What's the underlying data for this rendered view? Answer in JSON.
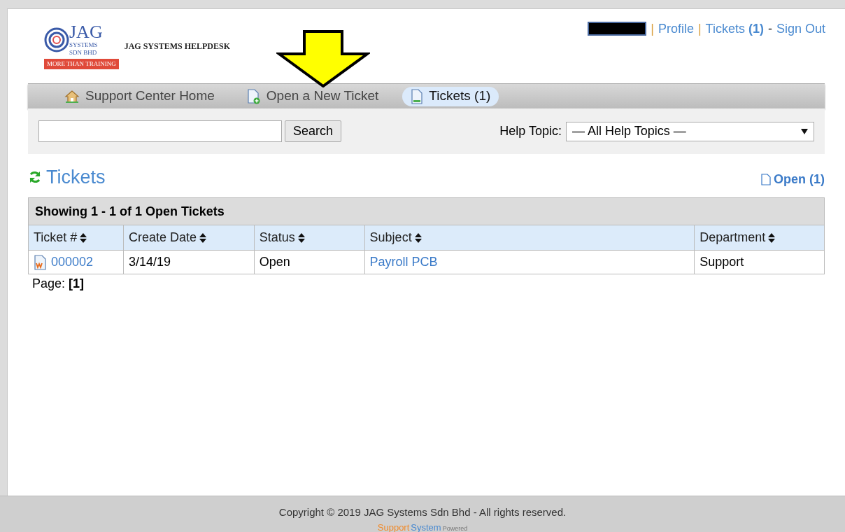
{
  "header": {
    "logo": {
      "main": "JAG",
      "sub": "SYSTEMS SDN BHD",
      "tagline": "MORE THAN TRAINING"
    },
    "site_title": "JAG SYSTEMS HELPDESK",
    "user_nav": [
      {
        "kind": "separator",
        "text": "|"
      },
      {
        "kind": "link",
        "text": "Profile"
      },
      {
        "kind": "separator",
        "text": "|"
      },
      {
        "kind": "link",
        "text": "Tickets **(1)**"
      },
      {
        "kind": "dash",
        "text": "-"
      },
      {
        "kind": "link",
        "text": "Sign Out"
      }
    ]
  },
  "nav_tabs": [
    {
      "label": "Support Center Home",
      "kind": "home",
      "selected": false
    },
    {
      "label": "Open a New Ticket",
      "kind": "new",
      "selected": false
    },
    {
      "label": "Tickets (1)",
      "kind": "doc",
      "selected": true
    }
  ],
  "search": {
    "button": "Search"
  },
  "help_topic": {
    "label": "Help Topic:",
    "value": "— All Help Topics —"
  },
  "tickets": {
    "title": "Tickets",
    "filter": "Open (1)",
    "caption": "Showing 1 - 1 of 1 Open Tickets",
    "columns": [
      "Ticket #",
      "Create Date",
      "Status",
      "Subject",
      "Department"
    ],
    "rows": [
      {
        "ticket": "000002",
        "date": "3/14/19",
        "status": "Open",
        "subject": "Payroll PCB",
        "department": "Support"
      }
    ],
    "page_label": "Page:",
    "page": "[1]"
  },
  "footer": {
    "copyright": "Copyright © 2019 JAG Systems Sdn Bhd - All rights reserved.",
    "brand_a": "Support",
    "brand_b": "System",
    "powered": "Powered"
  }
}
